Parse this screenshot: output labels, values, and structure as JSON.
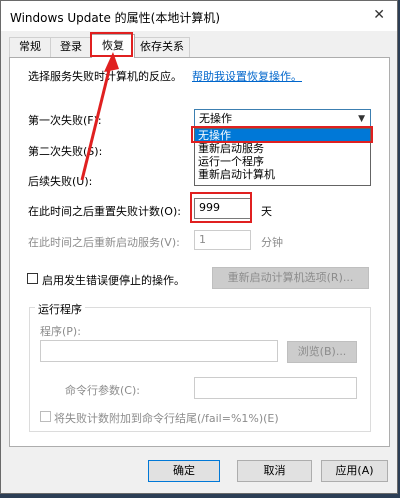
{
  "window": {
    "title": "Windows Update 的属性(本地计算机)",
    "close_glyph": "✕"
  },
  "tabs": [
    {
      "label": "常规",
      "active": false
    },
    {
      "label": "登录",
      "active": false
    },
    {
      "label": "恢复",
      "active": true
    },
    {
      "label": "依存关系",
      "active": false
    }
  ],
  "recovery": {
    "intro": "选择服务失败时计算机的反应。",
    "help_link": "帮助我设置恢复操作。",
    "first_failure_label": "第一次失败(F):",
    "second_failure_label": "第二次失败(S):",
    "subsequent_failure_label": "后续失败(U):",
    "first_failure_value": "无操作",
    "dropdown_options": [
      "无操作",
      "重新启动服务",
      "运行一个程序",
      "重新启动计算机"
    ],
    "reset_count_label": "在此时间之后重置失败计数(O):",
    "reset_count_value": "999",
    "reset_count_unit": "天",
    "restart_service_label": "在此时间之后重新启动服务(V):",
    "restart_service_value": "1",
    "restart_service_unit": "分钟",
    "stop_errors_label": "启用发生错误便停止的操作。",
    "restart_computer_options_button": "重新启动计算机选项(R)..."
  },
  "run_program": {
    "group_title": "运行程序",
    "program_label": "程序(P):",
    "program_value": "",
    "browse_button": "浏览(B)...",
    "cmd_params_label": "命令行参数(C):",
    "cmd_params_value": "",
    "append_fail_count_label": "将失败计数附加到命令行结尾(/fail=%1%)(E)"
  },
  "footer": {
    "ok": "确定",
    "cancel": "取消",
    "apply": "应用(A)"
  },
  "colors": {
    "highlight": "#0078d7",
    "annotation_red": "#e02020"
  }
}
